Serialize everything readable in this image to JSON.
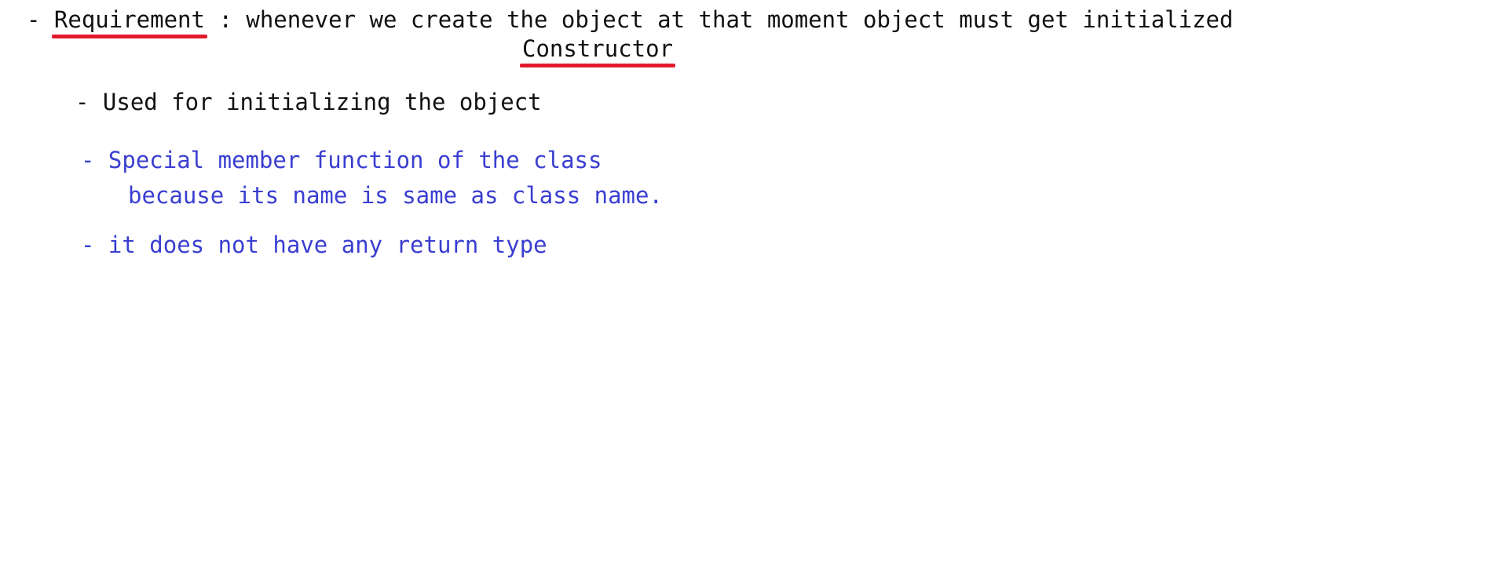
{
  "colors": {
    "main_text": "#111111",
    "note_text": "#3a3ed0",
    "underline": "#e21b2c"
  },
  "requirement": {
    "dash": "- ",
    "term": "Requirement",
    "rest": " : whenever we create the object at that moment object must get initialized"
  },
  "answer": {
    "term": "Constructor"
  },
  "points": {
    "used_for": "- Used for initializing the object",
    "special_member": "- Special member function of the class",
    "special_member_reason": "because its name is same as class name.",
    "no_return": "- it does not have any return type"
  }
}
